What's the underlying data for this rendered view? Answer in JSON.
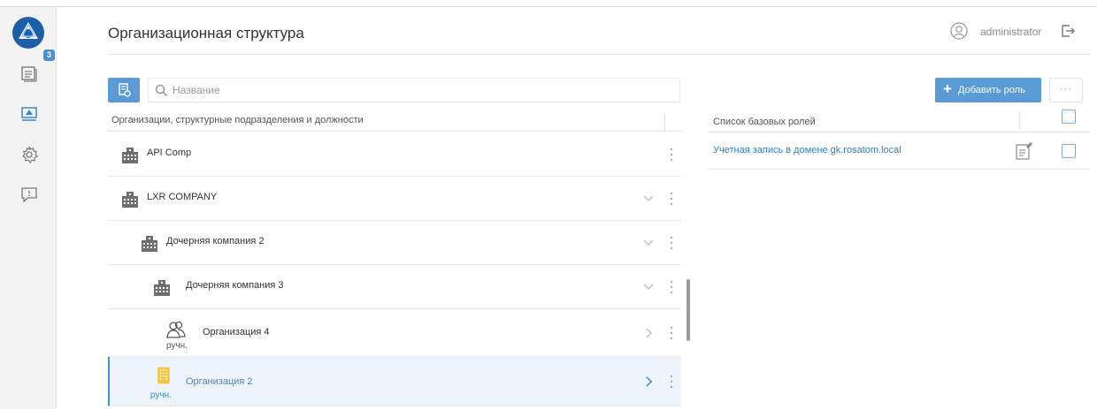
{
  "header": {
    "title": "Организационная структура",
    "user_name": "administrator"
  },
  "sidebar": {
    "items": [
      {
        "icon": "messages-icon",
        "badge": "3"
      },
      {
        "icon": "monitor-icon"
      },
      {
        "icon": "gear-icon"
      },
      {
        "icon": "feedback-icon"
      }
    ]
  },
  "left_panel": {
    "search_placeholder": "Название",
    "column_header": "Организации, структурные подразделения и должности",
    "rows": [
      {
        "label": "API Comp",
        "icon": "building-icon",
        "chevron": "none"
      },
      {
        "label": "LXR COMPANY",
        "icon": "building-icon",
        "chevron": "down"
      },
      {
        "label": "Дочерняя компания 2",
        "icon": "building-icon",
        "chevron": "down"
      },
      {
        "label": "Дочерняя компания 3",
        "icon": "building-icon",
        "chevron": "down"
      },
      {
        "label": "Организация 4",
        "icon": "users-icon",
        "tag": "ручн.",
        "chevron": "right"
      },
      {
        "label": "Организация 2",
        "icon": "building-yellow-icon",
        "tag": "ручн.",
        "chevron": "right",
        "selected": true
      }
    ]
  },
  "right_panel": {
    "add_role_label": "Добавить роль",
    "more_label": "···",
    "column_header": "Список базовых ролей",
    "roles": [
      {
        "name": "Учетная запись в домене gk.rosatom.local"
      }
    ]
  },
  "colors": {
    "accent": "#5b9bd5",
    "link": "#2f7fc4",
    "selected_bg": "#eef4fb"
  }
}
